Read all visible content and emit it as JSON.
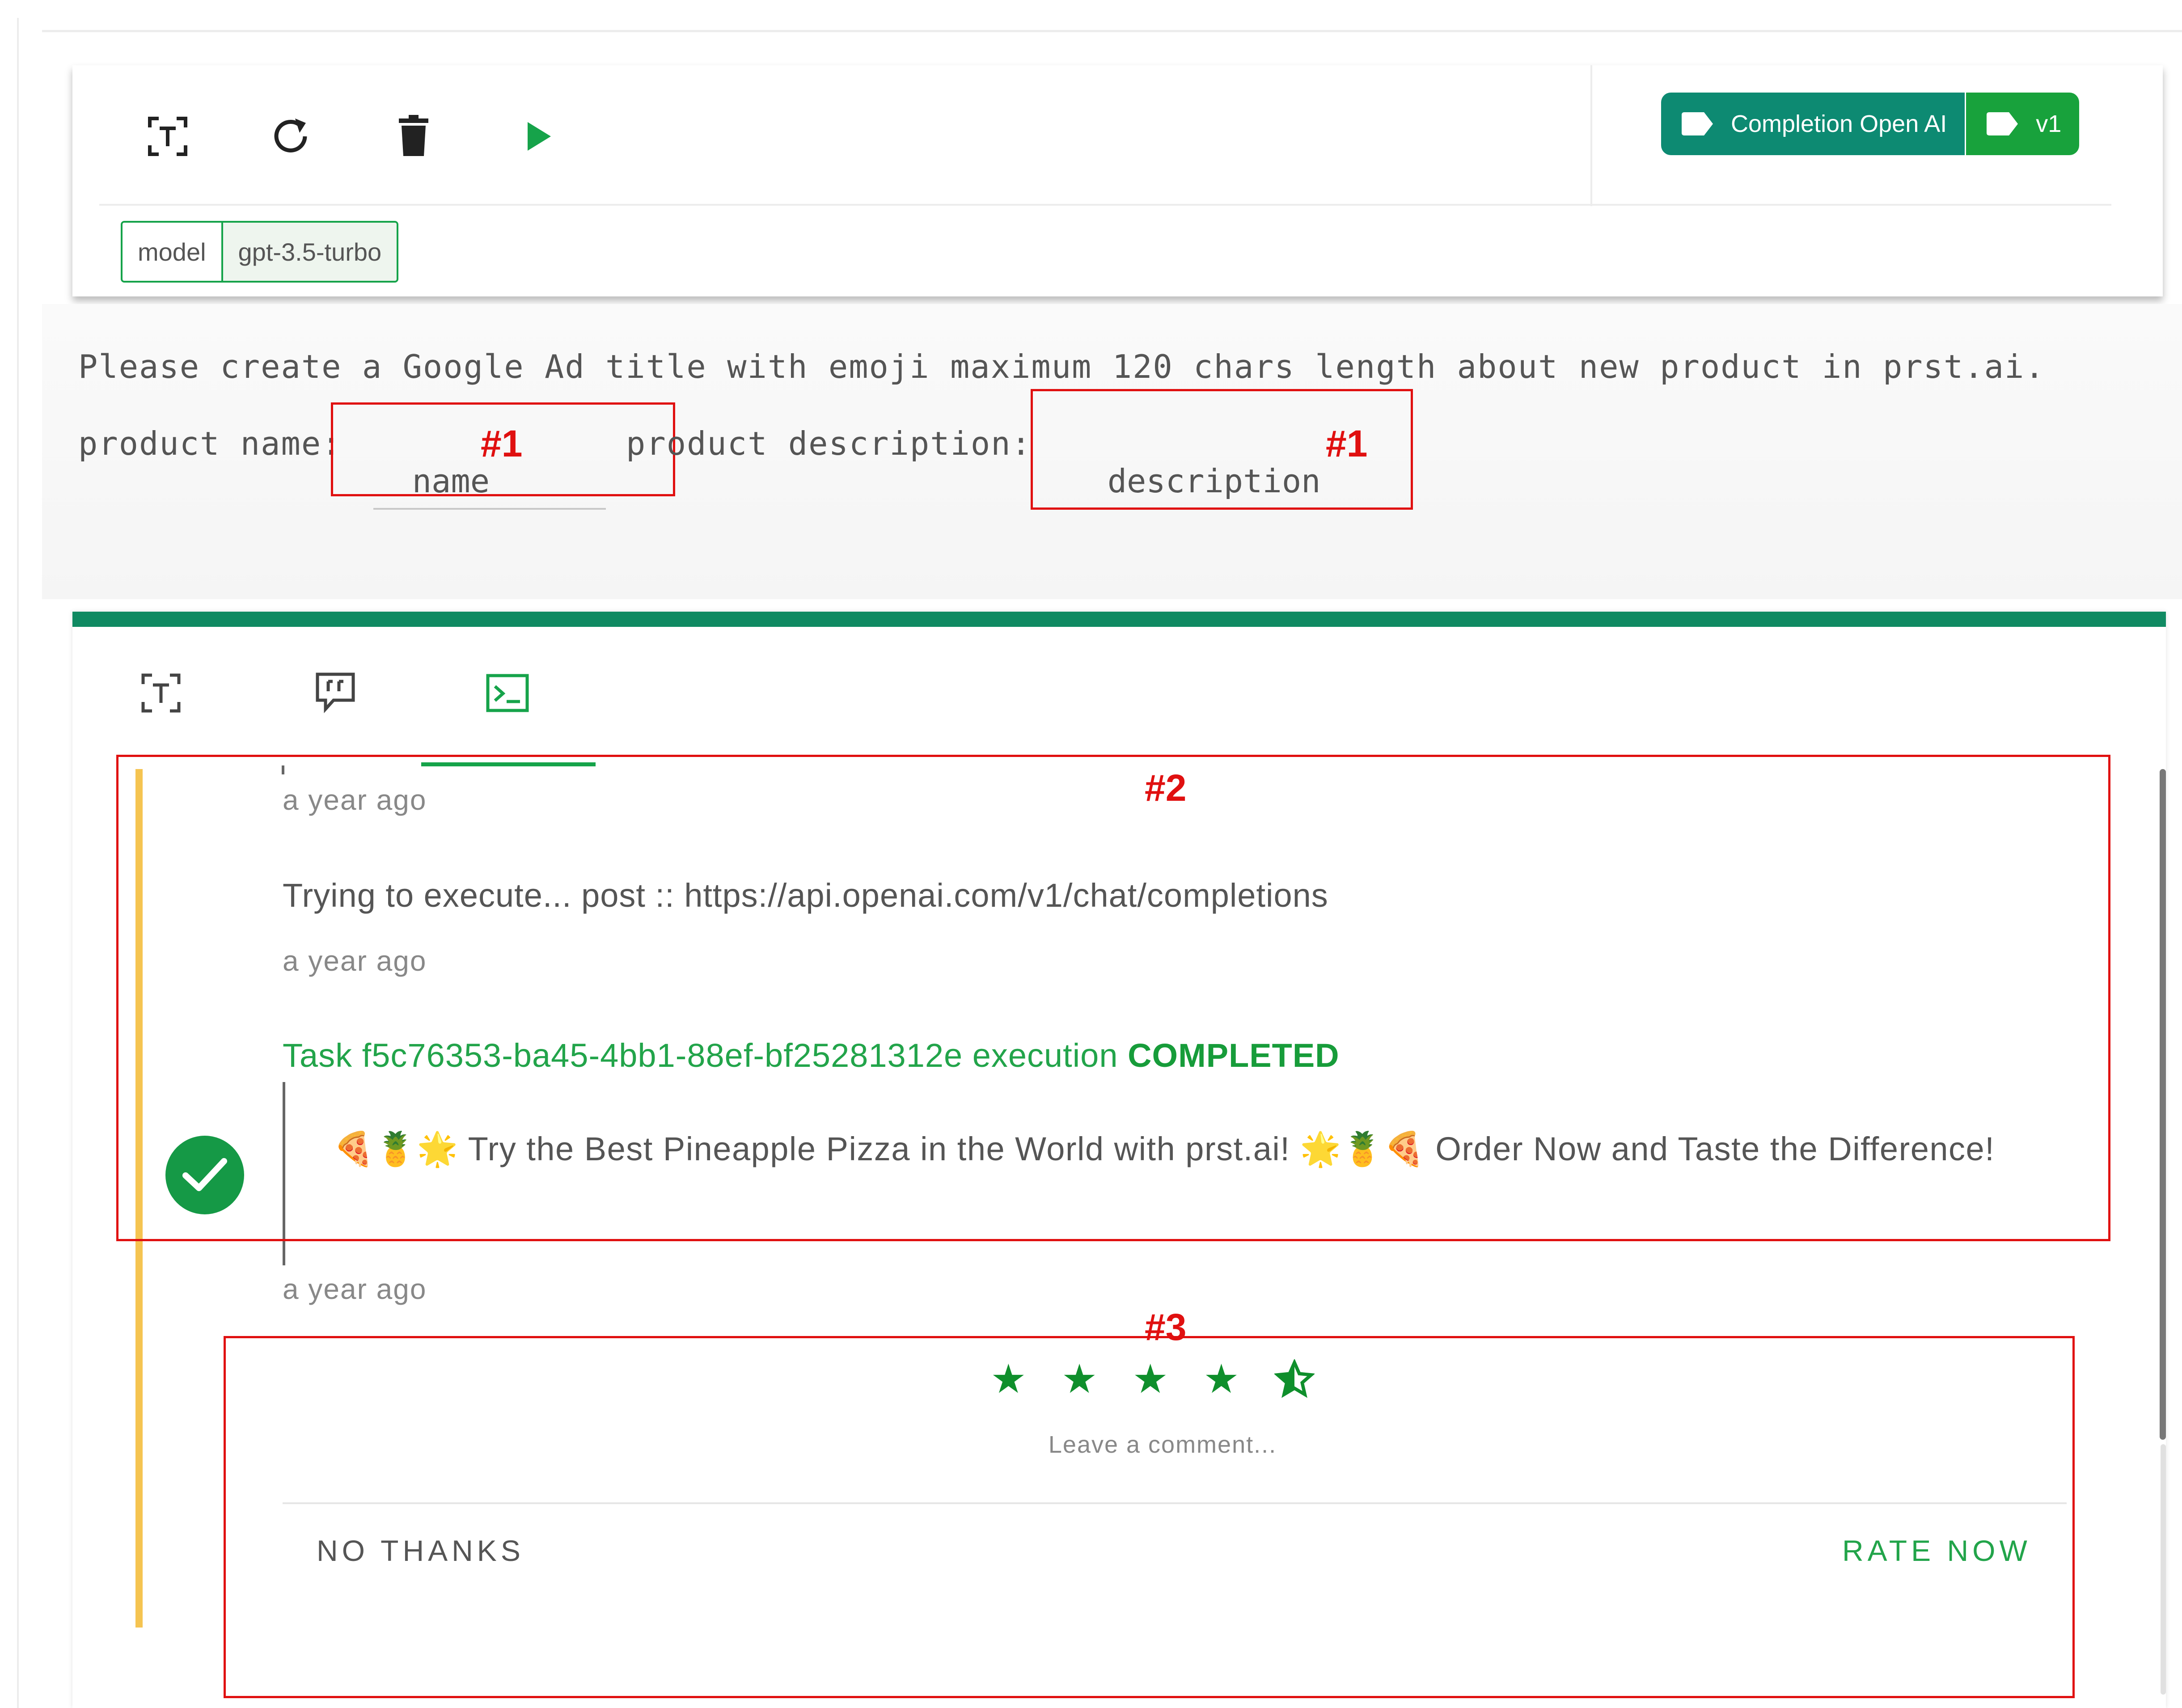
{
  "toolbar": {
    "icons": [
      "text-format-icon",
      "refresh-icon",
      "trash-icon",
      "play-icon"
    ],
    "model_key": "model",
    "model_value": "gpt-3.5-turbo",
    "badge_label": "Completion Open AI",
    "badge_version": "v1"
  },
  "prompt": {
    "line1": "Please create a Google Ad title with emoji maximum 120 chars length about new product in prst.ai.",
    "name_label": "product name:",
    "name_value": "name",
    "name_tag": "#1",
    "desc_label": "product description:",
    "desc_value": "description",
    "desc_tag": "#1"
  },
  "output": {
    "tabs": [
      "text-format-icon",
      "quote-icon",
      "terminal-icon"
    ],
    "active_tab": 2,
    "ts1": "a year ago",
    "log1": "Trying to execute... post :: https://api.openai.com/v1/chat/completions",
    "ts2": "a year ago",
    "task_prefix": "Task f5c76353-ba45-4bb1-88ef-bf25281312e execution",
    "task_status": "COMPLETED",
    "response": "🍕🍍🌟 Try the Best Pineapple Pizza in the World with prst.ai! 🌟🍍🍕 Order Now and Taste the Difference!",
    "ts3": "a year ago",
    "annotation2": "#2",
    "annotation3": "#3"
  },
  "rating": {
    "stars": 4.5,
    "max_stars": 5,
    "comment_placeholder": "Leave a comment...",
    "no_thanks": "NO THANKS",
    "rate_now": "RATE NOW"
  },
  "colors": {
    "accent_green": "#16a34a",
    "teal": "#0d8a72",
    "annotation_red": "#e01010",
    "timeline_yellow": "#f5c451"
  }
}
